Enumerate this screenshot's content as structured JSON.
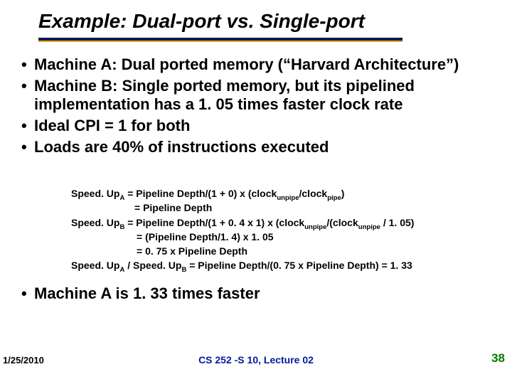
{
  "title": "Example: Dual-port vs. Single-port",
  "bullets": [
    "Machine A: Dual ported memory (“Harvard Architecture”)",
    "Machine B: Single ported memory, but its pipelined implementation has a 1. 05 times faster clock rate",
    "Ideal CPI = 1 for both",
    "Loads are 40% of instructions executed"
  ],
  "math": {
    "l1a": "Speed. Up",
    "l1b": " = Pipeline Depth/(1 + 0) x (clock",
    "l1c": "/clock",
    "l1d": ")",
    "l2": "= Pipeline Depth",
    "l3a": "Speed. Up",
    "l3b": " = Pipeline Depth/(1 + 0. 4 x 1) x (clock",
    "l3c": "/(clock",
    "l3d": " / 1. 05)",
    "l4": "= (Pipeline Depth/1. 4) x  1. 05",
    "l5": "= 0. 75 x Pipeline Depth",
    "l6a": "Speed. Up",
    "l6b": " / Speed. Up",
    "l6c": " = Pipeline Depth/(0. 75 x Pipeline Depth) = 1. 33",
    "subA": "A",
    "subB": "B",
    "sub_unpipe": "unpipe",
    "sub_pipe": "pipe"
  },
  "conclusion": "Machine A is 1. 33 times faster",
  "footer": {
    "date": "1/25/2010",
    "center": "CS 252 -S 10, Lecture 02",
    "page": "38"
  },
  "bullet_glyph": "•"
}
